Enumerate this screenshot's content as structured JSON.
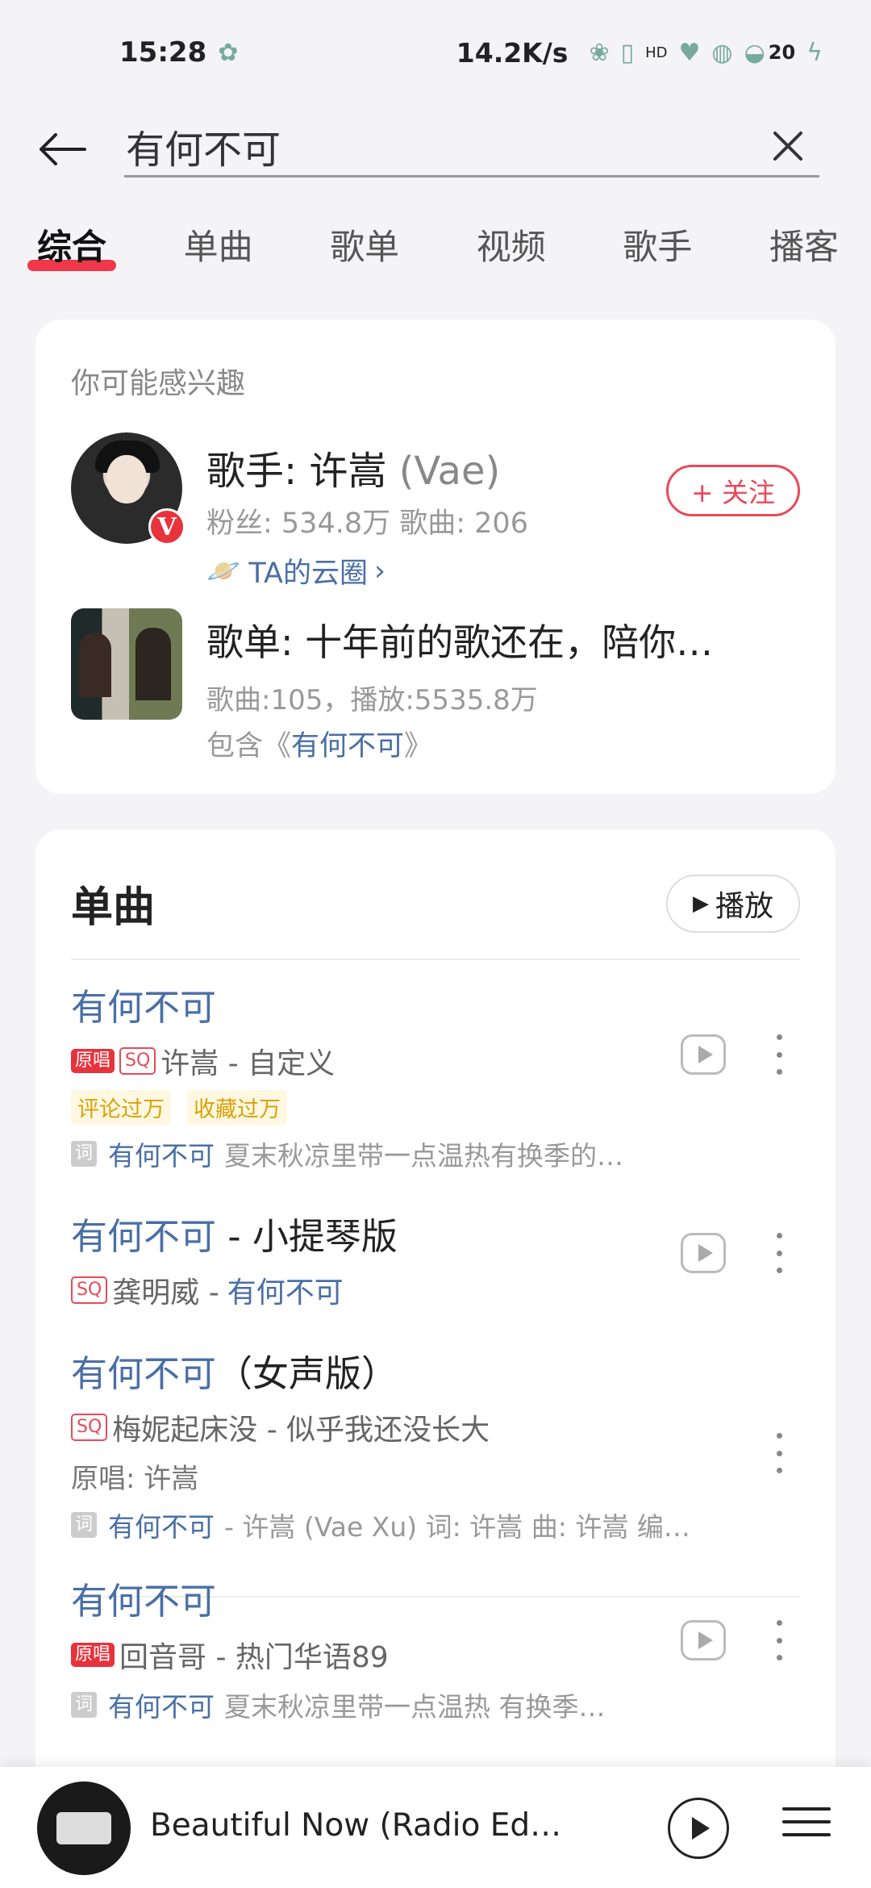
{
  "status_bar": {
    "time": "15:28",
    "net_speed": "14.2K/s",
    "hd": "HD",
    "battery": "20"
  },
  "search": {
    "query": "有何不可"
  },
  "tabs": [
    "综合",
    "单曲",
    "歌单",
    "视频",
    "歌手",
    "播客"
  ],
  "interest": {
    "hint": "你可能感兴趣",
    "artist": {
      "title": "歌手: 许嵩",
      "alias": "(Vae)",
      "stats": "粉丝: 534.8万 歌曲: 206",
      "link": "TA的云圈",
      "badge": "V",
      "follow": "+ 关注"
    },
    "playlist": {
      "title": "歌单: 十年前的歌还在，陪你…",
      "stats": "歌曲:105，播放:5535.8万",
      "include_prefix": "包含《",
      "include_song": "有何不可",
      "include_suffix": "》"
    }
  },
  "singles": {
    "title": "单曲",
    "play_all": "播放",
    "songs": [
      {
        "title": "有何不可",
        "tags": [
          "原唱",
          "SQ"
        ],
        "meta": "许嵩 - 自定义",
        "badges": [
          "评论过万",
          "收藏过万"
        ],
        "lyric_tag": "词",
        "lyric_key": "有何不可",
        "lyric_rest": "夏末秋凉里带一点温热有换季的…"
      },
      {
        "title": "有何不可",
        "title_rest": " - 小提琴版",
        "tags": [
          "SQ"
        ],
        "meta": "龚明威 - ",
        "meta_blue": "有何不可"
      },
      {
        "title": "有何不可",
        "title_rest": "（女声版）",
        "tags": [
          "SQ"
        ],
        "meta": "梅妮起床没 - 似乎我还没长大",
        "origin": "原唱: 许嵩",
        "lyric_tag": "词",
        "lyric_key": "有何不可",
        "lyric_rest": "- 许嵩 (Vae Xu) 词: 许嵩 曲: 许嵩 编…"
      },
      {
        "title": "有何不可",
        "tags": [
          "原唱"
        ],
        "meta": "回音哥 - 热门华语89",
        "lyric_tag": "词",
        "lyric_key": "有何不可",
        "lyric_rest": "夏末秋凉里带一点温热 有换季…"
      }
    ]
  },
  "mini_player": {
    "title": "Beautiful Now (Radio Edit)..."
  }
}
